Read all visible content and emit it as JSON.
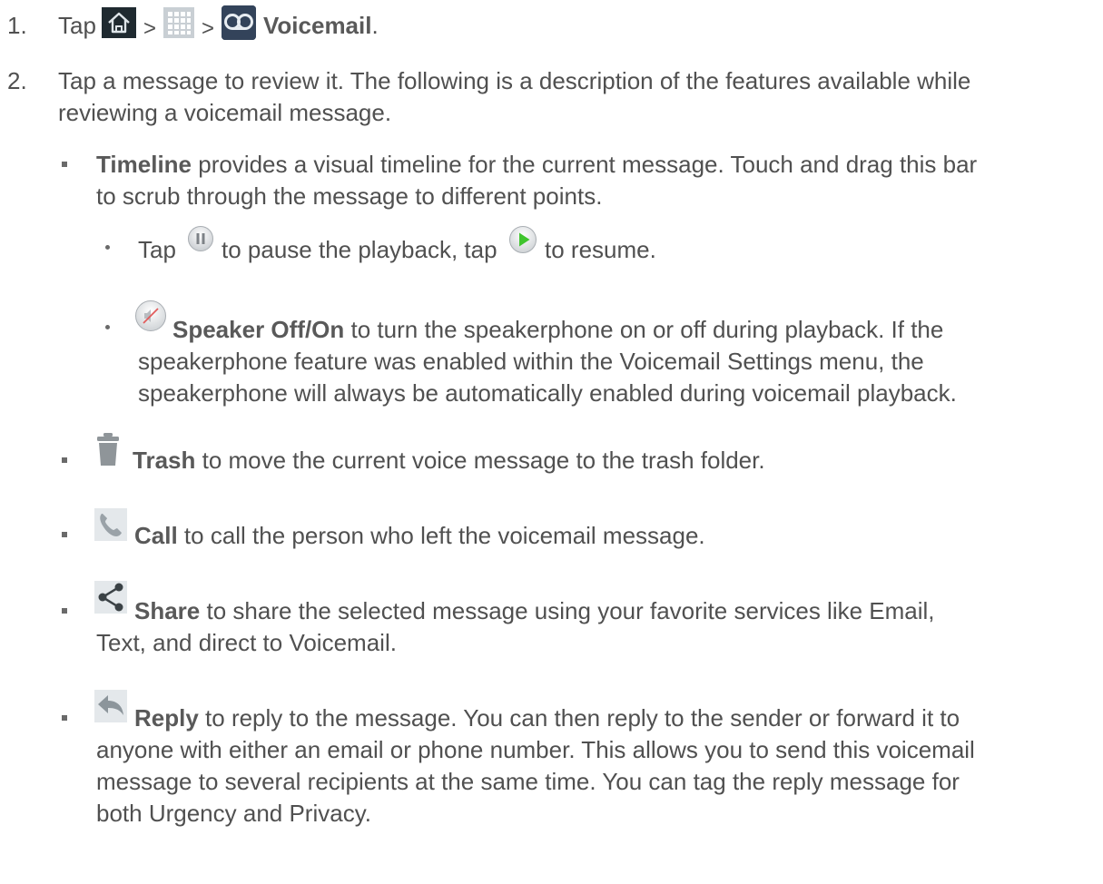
{
  "step1": {
    "number": "1.",
    "tap": "Tap",
    "sep1": ">",
    "sep2": ">",
    "voicemail": "Voicemail",
    "end": ".",
    "icons": [
      "home-icon",
      "apps-grid-icon",
      "voicemail-app-icon"
    ]
  },
  "step2": {
    "number": "2.",
    "line1": "Tap a message to review it. The following is a description of the features available while",
    "line2": "reviewing a voicemail message."
  },
  "timeline": {
    "bold": "Timeline",
    "line1_rest": " provides a visual timeline for the current message. Touch and drag this bar",
    "line2": "to scrub through the message to different points."
  },
  "pause": {
    "tap": "Tap",
    "mid": "to pause the playback, tap",
    "end": "to resume.",
    "icons": [
      "pause-icon",
      "play-icon"
    ]
  },
  "speaker": {
    "bold": "Speaker Off/On",
    "line1_rest": " to turn the speakerphone on or off during playback. If the",
    "line2": "speakerphone feature was enabled within the Voicemail Settings menu, the",
    "line3": "speakerphone will always be automatically enabled during voicemail playback.",
    "icon": "speaker-off-icon"
  },
  "trash": {
    "bold": "Trash",
    "rest": " to move the current voice message to the trash folder.",
    "icon": "trash-icon"
  },
  "call": {
    "bold": "Call",
    "rest": " to call the person who left the voicemail message.",
    "icon": "phone-icon"
  },
  "share": {
    "bold": "Share",
    "line1_rest": " to share the selected message using your favorite services like Email,",
    "line2": "Text, and direct to Voicemail.",
    "icon": "share-icon"
  },
  "reply": {
    "bold": "Reply",
    "line1_rest": " to reply to the message. You can then reply to the sender or forward it to",
    "line2": "anyone with either an email or phone number. This allows you to send this voicemail",
    "line3": "message to several recipients at the same time. You can tag the reply message for",
    "line4": "both Urgency and Privacy.",
    "icon": "reply-icon"
  }
}
